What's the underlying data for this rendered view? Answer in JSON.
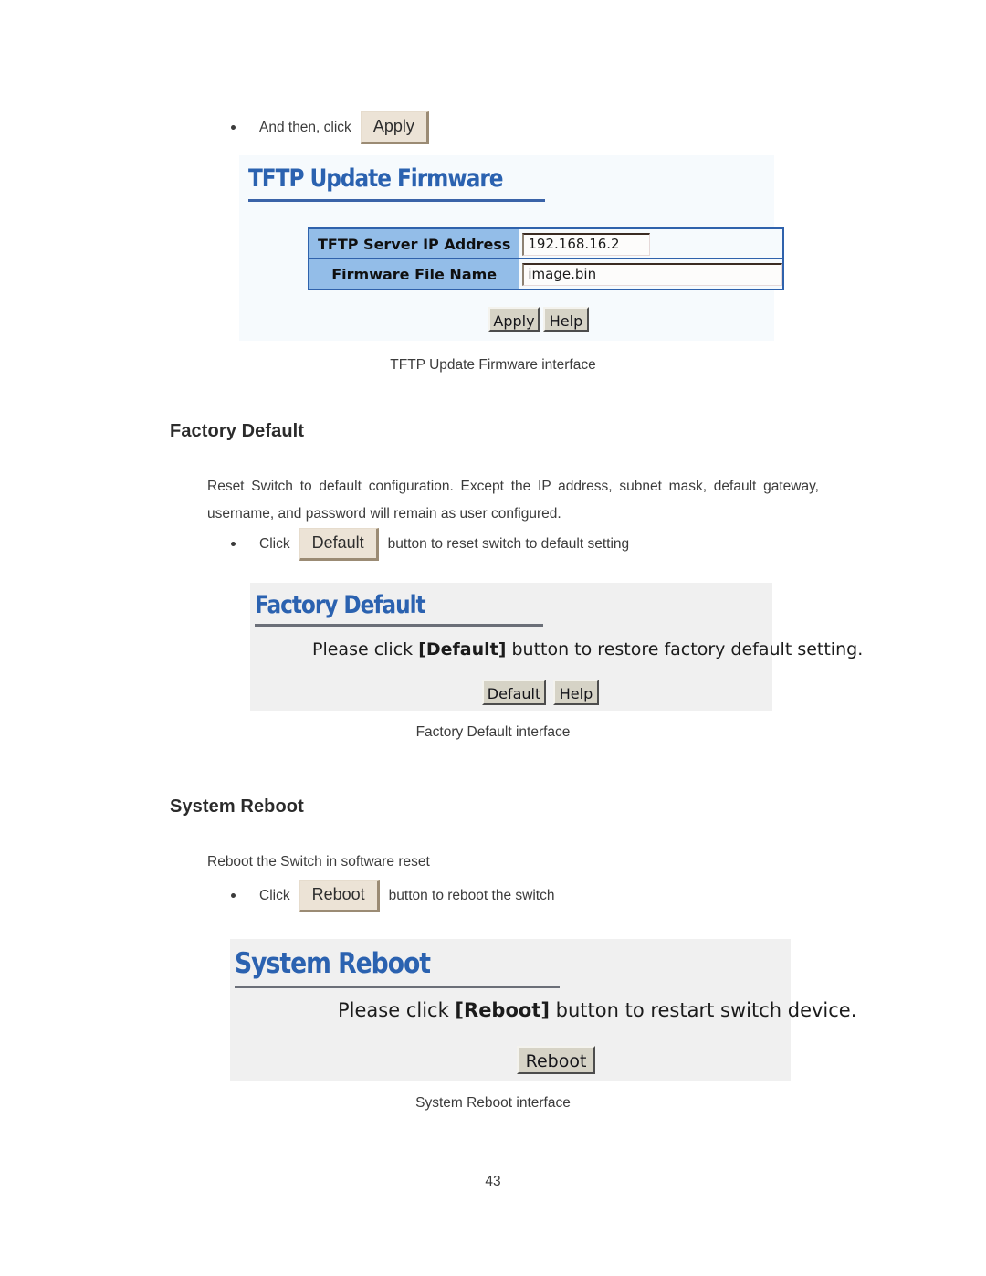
{
  "page": {
    "number": "43"
  },
  "tftp_section": {
    "bullet": {
      "prefix": "And then, click",
      "button_label": "Apply"
    },
    "screenshot": {
      "title": "TFTP Update Firmware",
      "rows": [
        {
          "label": "TFTP Server IP Address",
          "value": "192.168.16.2"
        },
        {
          "label": "Firmware File Name",
          "value": "image.bin"
        }
      ],
      "buttons": [
        {
          "label": "Apply"
        },
        {
          "label": "Help"
        }
      ]
    },
    "caption": "TFTP Update Firmware interface"
  },
  "factory_default_section": {
    "heading": "Factory Default",
    "paragraph": "Reset Switch to default configuration. Except the IP address, subnet mask, default gateway, username, and password will remain as user configured.",
    "bullet": {
      "prefix": "Click",
      "button_label": "Default",
      "suffix": "button to reset switch to default setting"
    },
    "screenshot": {
      "title": "Factory Default",
      "message_prefix": "Please click ",
      "message_bold": "[Default]",
      "message_suffix": " button to restore factory default setting.",
      "buttons": [
        {
          "label": "Default"
        },
        {
          "label": "Help"
        }
      ]
    },
    "caption": "Factory Default interface"
  },
  "system_reboot_section": {
    "heading": "System Reboot",
    "paragraph": "Reboot the Switch in software reset",
    "bullet": {
      "prefix": "Click",
      "button_label": "Reboot",
      "suffix": "button to reboot the switch"
    },
    "screenshot": {
      "title": "System Reboot",
      "message_prefix": "Please click ",
      "message_bold": "[Reboot]",
      "message_suffix": " button to restart switch device.",
      "buttons": [
        {
          "label": "Reboot"
        }
      ]
    },
    "caption": "System Reboot interface"
  },
  "colors": {
    "heading_blue": "#2b62b0",
    "table_label_blue": "#93bde8",
    "table_border_blue": "#2f62ac",
    "panel_blue_bg": "#f6fafd",
    "panel_gray_bg": "#f0f0f0",
    "inline_button_beige": "#ece3d6",
    "win_button_gray": "#d6d3c6"
  }
}
